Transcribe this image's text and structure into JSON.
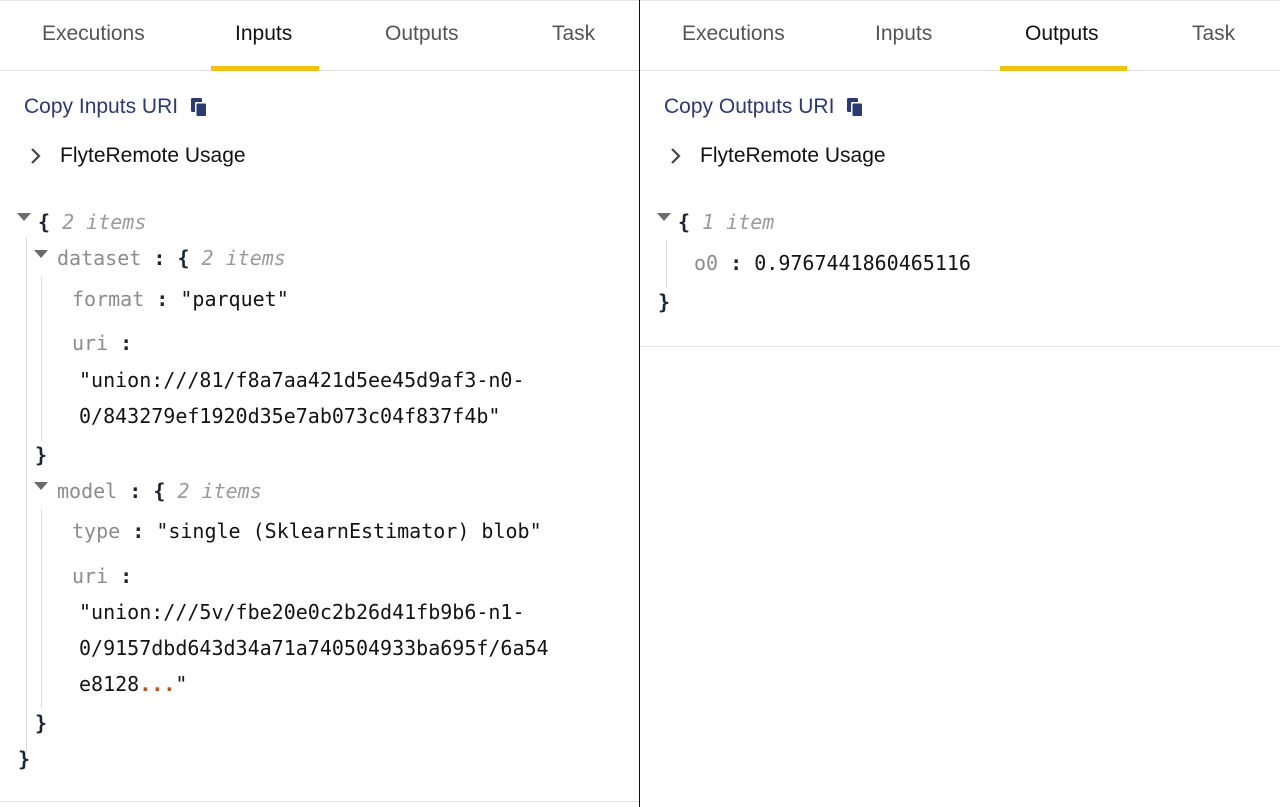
{
  "left": {
    "tabs": [
      {
        "label": "Executions",
        "active": false
      },
      {
        "label": "Inputs",
        "active": true
      },
      {
        "label": "Outputs",
        "active": false
      },
      {
        "label": "Task",
        "active": false
      }
    ],
    "copy_label": "Copy Inputs URI",
    "usage_label": "FlyteRemote Usage",
    "json": {
      "root_count": "2 items",
      "dataset": {
        "key": "dataset",
        "count": "2 items",
        "format_key": "format",
        "format_value": "\"parquet\"",
        "uri_key": "uri",
        "uri_line1": "\"union:///81/f8a7aa421d5ee45d9af3-n0-",
        "uri_line2": "0/843279ef1920d35e7ab073c04f837f4b\""
      },
      "model": {
        "key": "model",
        "count": "2 items",
        "type_key": "type",
        "type_value": "\"single (SklearnEstimator) blob\"",
        "uri_key": "uri",
        "uri_line1": "\"union:///5v/fbe20e0c2b26d41fb9b6-n1-",
        "uri_line2": "0/9157dbd643d34a71a740504933ba695f/6a54",
        "uri_line3_start": "e8128",
        "uri_ellipsis": "...",
        "uri_line3_end": "\""
      }
    }
  },
  "right": {
    "tabs": [
      {
        "label": "Executions",
        "active": false
      },
      {
        "label": "Inputs",
        "active": false
      },
      {
        "label": "Outputs",
        "active": true
      },
      {
        "label": "Task",
        "active": false
      }
    ],
    "copy_label": "Copy Outputs URI",
    "usage_label": "FlyteRemote Usage",
    "json": {
      "root_count": "1 item",
      "o0_key": "o0",
      "o0_value": "0.9767441860465116"
    }
  },
  "syntax": {
    "open_brace": "{",
    "close_brace": "}",
    "colon": ":"
  },
  "colors": {
    "accent_underline": "#f2c10f",
    "link": "#2c3a72",
    "ellipsis": "#c24f1b"
  },
  "icons": [
    "copy-icon",
    "chevron-right-icon",
    "caret-down-icon"
  ]
}
